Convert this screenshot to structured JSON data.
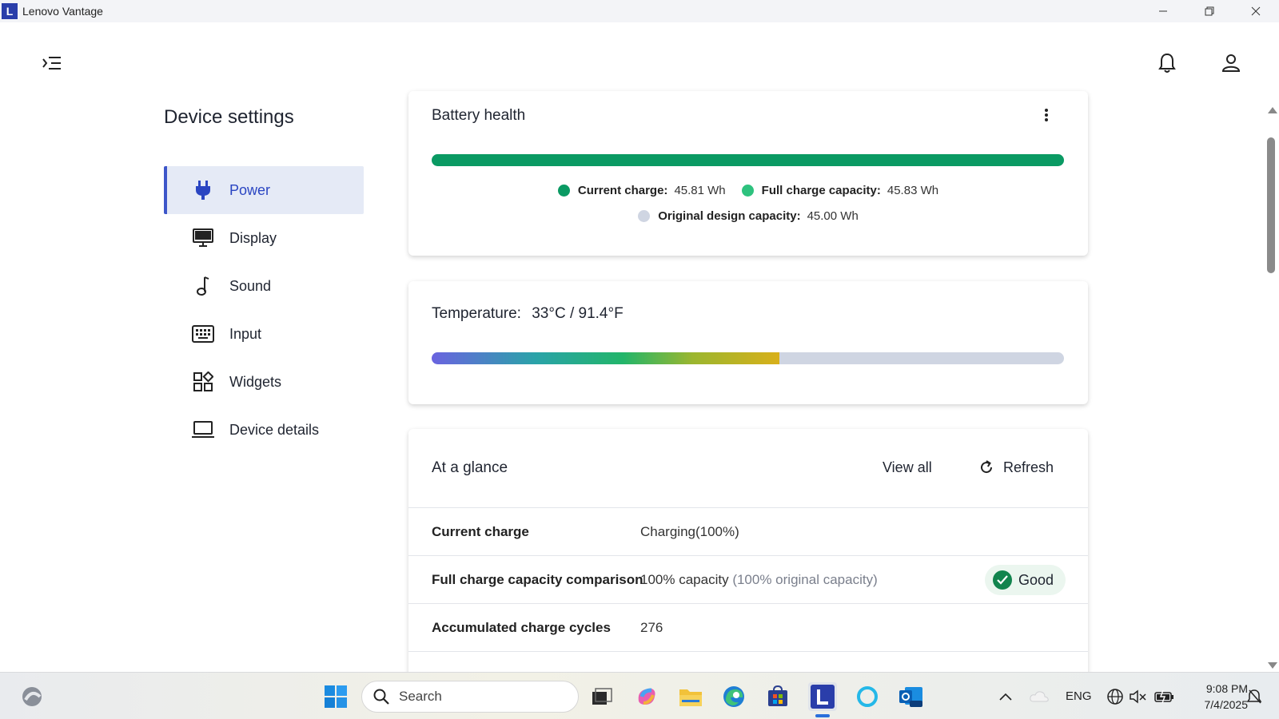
{
  "window": {
    "app_logo_letter": "L",
    "title": "Lenovo Vantage"
  },
  "sidebar": {
    "title": "Device settings",
    "items": [
      {
        "label": "Power",
        "icon": "plug-icon",
        "active": true
      },
      {
        "label": "Display",
        "icon": "monitor-icon"
      },
      {
        "label": "Sound",
        "icon": "music-note-icon"
      },
      {
        "label": "Input",
        "icon": "keyboard-icon"
      },
      {
        "label": "Widgets",
        "icon": "widgets-icon"
      },
      {
        "label": "Device details",
        "icon": "laptop-icon"
      }
    ]
  },
  "battery_health": {
    "title": "Battery health",
    "fill_fraction": 1.0,
    "legend": {
      "current_label": "Current charge:",
      "current_value": "45.81 Wh",
      "full_label": "Full charge capacity:",
      "full_value": "45.83 Wh",
      "design_label": "Original design capacity:",
      "design_value": "45.00 Wh"
    },
    "colors": {
      "current": "#0a9a63",
      "full": "#2ec27e",
      "design": "#cfd5e2"
    }
  },
  "temperature": {
    "title": "Temperature:",
    "value": "33°C / 91.4°F",
    "fill_fraction": 0.55
  },
  "glance": {
    "title": "At a glance",
    "view_all": "View all",
    "refresh": "Refresh",
    "rows": [
      {
        "label": "Current charge",
        "value": "Charging(100%)"
      },
      {
        "label": "Full charge capacity comparison",
        "value": "100% capacity",
        "muted": "(100% original capacity)",
        "badge": "Good"
      },
      {
        "label": "Accumulated charge cycles",
        "value": "276"
      }
    ]
  },
  "taskbar": {
    "search_placeholder": "Search",
    "lang": "ENG",
    "time": "9:08 PM",
    "date": "7/4/2025"
  }
}
